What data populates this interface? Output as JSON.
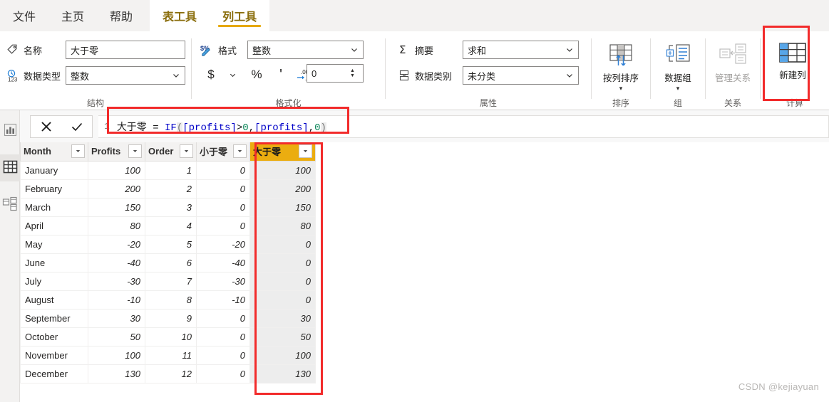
{
  "tabs": [
    {
      "label": "文件",
      "type": "normal",
      "active": false
    },
    {
      "label": "主页",
      "type": "normal",
      "active": false
    },
    {
      "label": "帮助",
      "type": "normal",
      "active": false
    },
    {
      "label": "表工具",
      "type": "contextual",
      "active": false
    },
    {
      "label": "列工具",
      "type": "contextual",
      "active": true
    }
  ],
  "ribbon": {
    "structure": {
      "group_label": "结构",
      "name_label": "名称",
      "name_icon": "tag-icon",
      "name_value": "大于零",
      "datatype_label": "数据类型",
      "datatype_icon": "clock-123-icon",
      "datatype_value": "整数"
    },
    "formatting": {
      "group_label": "格式化",
      "format_label": "格式",
      "format_icon": "currency-percent-pen-icon",
      "format_value": "整数",
      "currency_button": "$",
      "percent_button": "%",
      "thousands_button": "'",
      "decimal_button": ".00→.0",
      "decimal_places_value": "0"
    },
    "properties": {
      "group_label": "属性",
      "summarize_label": "摘要",
      "summarize_icon": "sigma-icon",
      "summarize_value": "求和",
      "datacategory_label": "数据类别",
      "datacategory_icon": "category-icon",
      "datacategory_value": "未分类"
    },
    "sort": {
      "group_label": "排序",
      "button_label": "按列排序",
      "button_icon": "sort-by-column-icon"
    },
    "groups": {
      "group_label": "组",
      "button_label": "数据组",
      "button_icon": "data-groups-icon"
    },
    "relationships": {
      "group_label": "关系",
      "button_label": "管理关系",
      "button_icon": "manage-relationships-icon",
      "disabled": true
    },
    "calculations": {
      "group_label": "计算",
      "button_label": "新建列",
      "button_icon": "new-column-icon",
      "highlighted": true
    }
  },
  "rail": [
    {
      "name": "report-view",
      "icon": "bar-chart-icon",
      "selected": false
    },
    {
      "name": "data-view",
      "icon": "table-icon",
      "selected": true
    },
    {
      "name": "model-view",
      "icon": "relationship-icon",
      "selected": false
    }
  ],
  "formula_bar": {
    "cancel_icon": "close-icon",
    "confirm_icon": "check-icon",
    "line_number": "1",
    "column_name": "大于零",
    "equals": " = ",
    "function": "IF",
    "open_paren": "(",
    "arg1_col": "[profits]",
    "operator": ">",
    "arg1_num": "0",
    "comma1": ",",
    "arg2_col": "[profits]",
    "comma2": ",",
    "arg3_num": "0",
    "close_paren": ")",
    "full_text": "大于零 = IF([profits]>0,[profits],0)"
  },
  "table": {
    "columns": [
      {
        "name": "Month",
        "align": "txt",
        "highlight": false
      },
      {
        "name": "Profits",
        "align": "num",
        "highlight": false
      },
      {
        "name": "Order",
        "align": "num",
        "highlight": false
      },
      {
        "name": "小于零",
        "align": "num",
        "highlight": false
      },
      {
        "name": "大于零",
        "align": "num",
        "highlight": true
      }
    ],
    "rows": [
      [
        "January",
        "100",
        "1",
        "0",
        "100"
      ],
      [
        "February",
        "200",
        "2",
        "0",
        "200"
      ],
      [
        "March",
        "150",
        "3",
        "0",
        "150"
      ],
      [
        "April",
        "80",
        "4",
        "0",
        "80"
      ],
      [
        "May",
        "-20",
        "5",
        "-20",
        "0"
      ],
      [
        "June",
        "-40",
        "6",
        "-40",
        "0"
      ],
      [
        "July",
        "-30",
        "7",
        "-30",
        "0"
      ],
      [
        "August",
        "-10",
        "8",
        "-10",
        "0"
      ],
      [
        "September",
        "30",
        "9",
        "0",
        "30"
      ],
      [
        "October",
        "50",
        "10",
        "0",
        "50"
      ],
      [
        "November",
        "100",
        "11",
        "0",
        "100"
      ],
      [
        "December",
        "130",
        "12",
        "0",
        "130"
      ]
    ]
  },
  "annotations": {
    "new_column_box": "red-highlight-box",
    "formula_box": "red-highlight-box",
    "column_box": "red-highlight-box"
  },
  "watermark": "CSDN @kejiayuan",
  "colors": {
    "contextual_tab": "#8a6d0b",
    "tab_underline": "#e6a800",
    "column_highlight": "#ebad10",
    "annotation_red": "#f22b2b",
    "accent_blue": "#1a7bd4"
  }
}
